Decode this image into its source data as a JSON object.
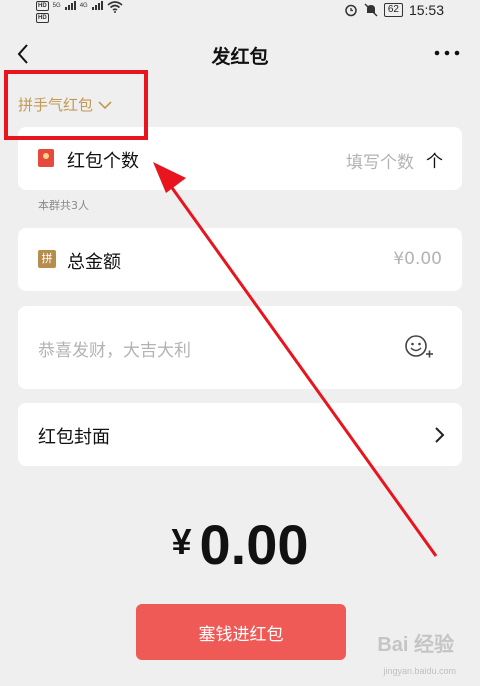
{
  "status_bar": {
    "hd_badge_1": "HD",
    "hd_badge_2": "HD",
    "net_1": "5G",
    "net_2": "4G",
    "battery": "62",
    "time": "15:53"
  },
  "header": {
    "title": "发红包",
    "back_icon": "chevron-left-icon",
    "more_icon": "more-dots-icon"
  },
  "packet_type": {
    "label": "拼手气红包",
    "icon": "chevron-down-icon"
  },
  "count_row": {
    "label": "红包个数",
    "placeholder": "填写个数",
    "icon": "red-packet-icon",
    "suffix": "个"
  },
  "group_hint": "本群共3人",
  "amount_row": {
    "badge": "拼",
    "label": "总金额",
    "value": "¥0.00"
  },
  "greeting": {
    "placeholder": "恭喜发财，大吉大利",
    "icon": "emoji-add-icon"
  },
  "cover_row": {
    "label": "红包封面",
    "icon": "chevron-right-icon"
  },
  "total": {
    "symbol": "¥",
    "value": "0.00"
  },
  "submit": {
    "label": "塞钱进红包"
  },
  "watermark": {
    "text": "Bai 经验",
    "sub": "jingyan.baidu.com"
  },
  "colors": {
    "accent": "#f05a56",
    "gold": "#c39a55",
    "annotation_red": "#e8141e",
    "background": "#efefef"
  }
}
